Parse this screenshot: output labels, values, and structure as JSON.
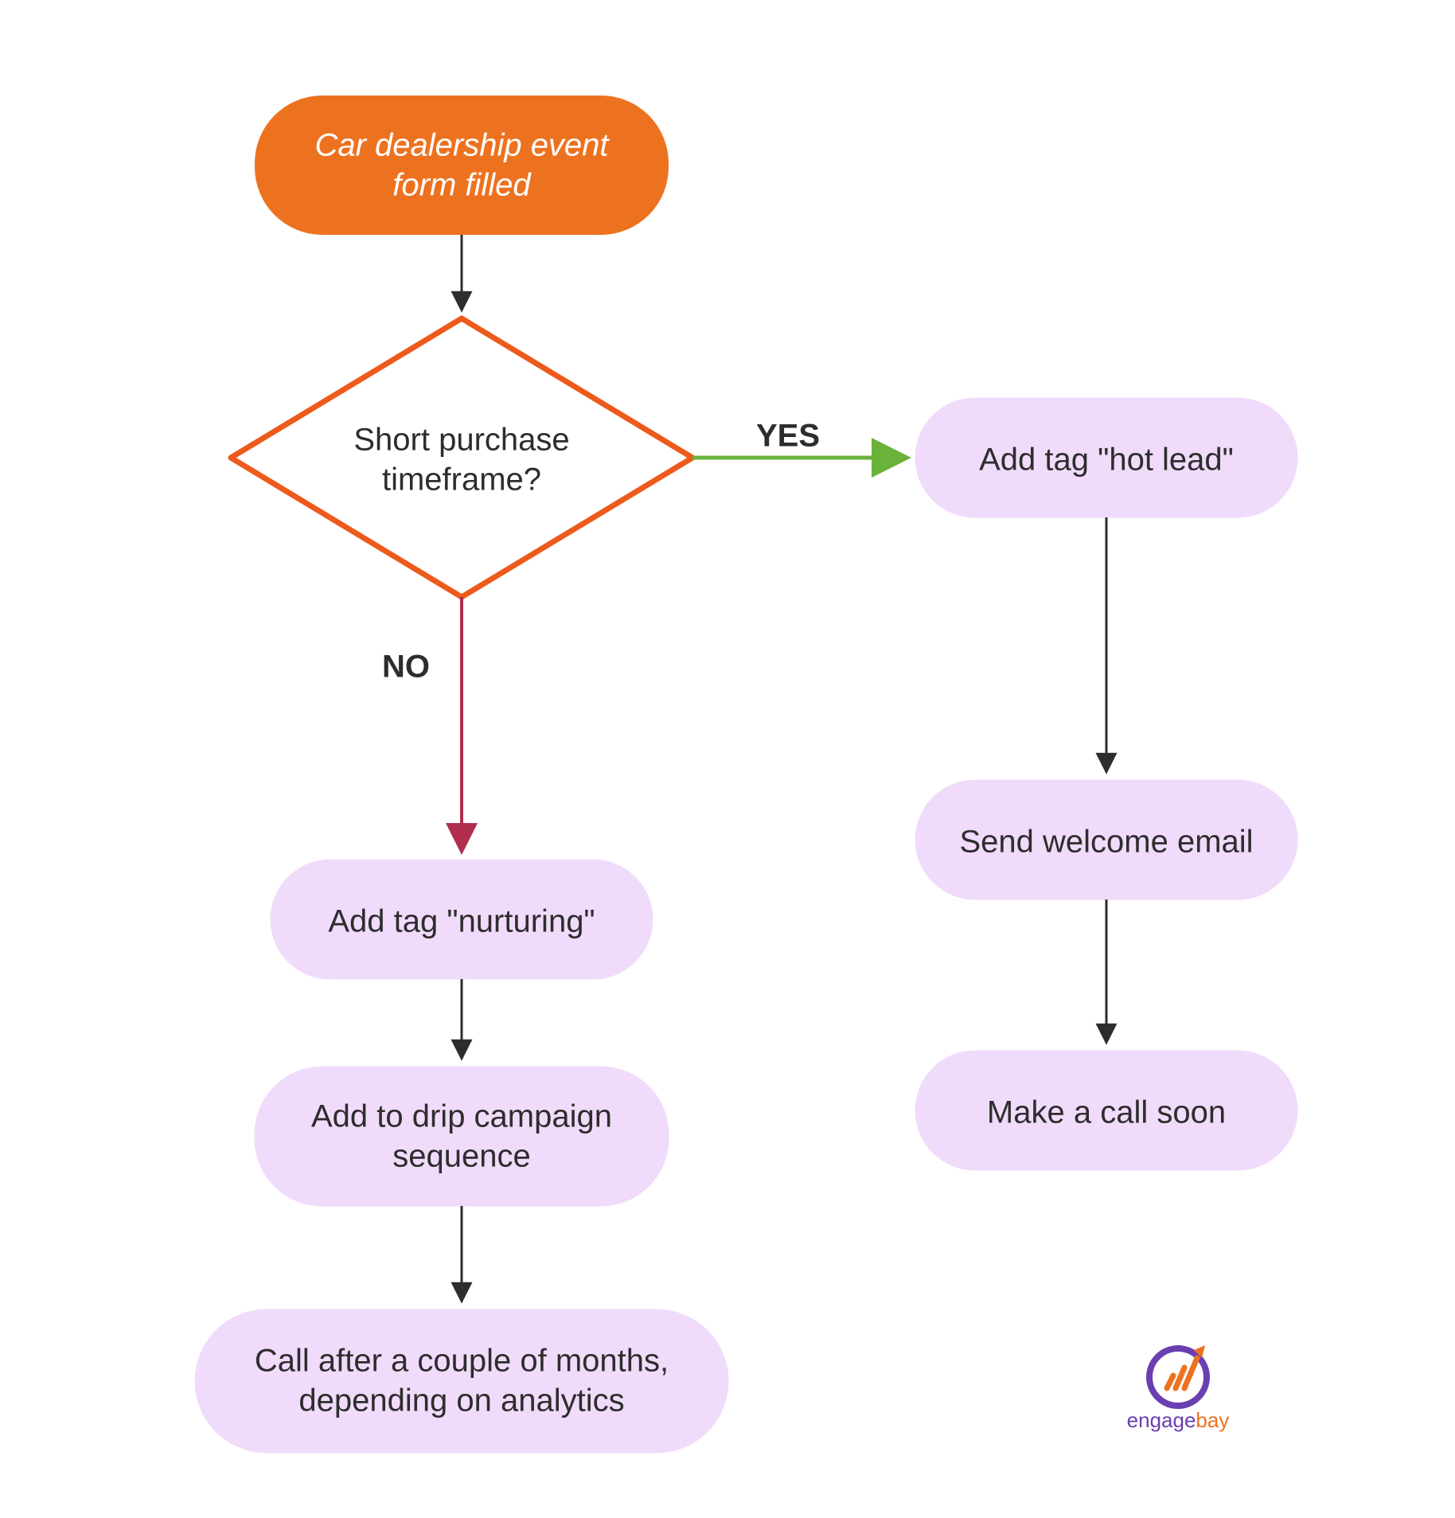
{
  "diagram": {
    "nodes": {
      "start": {
        "type": "start",
        "label_l1": "Car dealership event",
        "label_l2": "form filled"
      },
      "decision": {
        "type": "decision",
        "label_l1": "Short purchase",
        "label_l2": "timeframe?"
      },
      "hot_lead": {
        "type": "process",
        "label": "Add tag \"hot lead\""
      },
      "welcome": {
        "type": "process",
        "label": "Send welcome email"
      },
      "call_soon": {
        "type": "process",
        "label": "Make a call soon"
      },
      "nurturing": {
        "type": "process",
        "label": "Add tag \"nurturing\""
      },
      "drip_l1": "Add to drip campaign",
      "drip_l2": "sequence",
      "call_later_l1": "Call after a couple of months,",
      "call_later_l2": "depending on analytics"
    },
    "edges": {
      "yes": {
        "label": "YES",
        "color": "#6bb23b"
      },
      "no": {
        "label": "NO",
        "color": "#b02d4e"
      }
    },
    "colors": {
      "start_fill": "#ed7220",
      "decision_stroke": "#ed5a1b",
      "process_fill": "#f1dbfa",
      "yes_color": "#6bb23b",
      "no_color": "#b02d4e",
      "default_arrow": "#2d2d2d"
    },
    "logo": {
      "brand_prefix": "engage",
      "brand_suffix": "bay"
    }
  }
}
